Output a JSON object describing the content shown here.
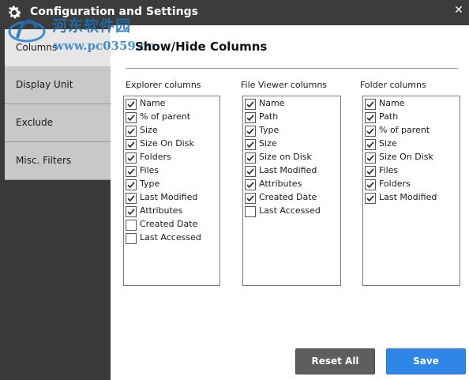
{
  "window": {
    "title": "Configuration and Settings",
    "close_glyph": "✕"
  },
  "watermark": {
    "name": "河东软件园",
    "url": "www.pc0359.cn"
  },
  "sidebar": {
    "items": [
      {
        "label": "Columns",
        "active": true
      },
      {
        "label": "Display Unit",
        "active": false
      },
      {
        "label": "Exclude",
        "active": false
      },
      {
        "label": "Misc. Filters",
        "active": false
      }
    ]
  },
  "main": {
    "title": "Show/Hide Columns",
    "groups": [
      {
        "heading": "Explorer columns",
        "items": [
          {
            "label": "Name",
            "checked": true
          },
          {
            "label": "% of parent",
            "checked": true
          },
          {
            "label": "Size",
            "checked": true
          },
          {
            "label": "Size On Disk",
            "checked": true
          },
          {
            "label": "Folders",
            "checked": true
          },
          {
            "label": "Files",
            "checked": true
          },
          {
            "label": "Type",
            "checked": true
          },
          {
            "label": "Last Modified",
            "checked": true
          },
          {
            "label": "Attributes",
            "checked": true
          },
          {
            "label": "Created Date",
            "checked": false
          },
          {
            "label": "Last Accessed",
            "checked": false
          }
        ]
      },
      {
        "heading": "File Viewer columns",
        "items": [
          {
            "label": "Name",
            "checked": true
          },
          {
            "label": "Path",
            "checked": true
          },
          {
            "label": "Type",
            "checked": true
          },
          {
            "label": "Size",
            "checked": true
          },
          {
            "label": "Size on Disk",
            "checked": true
          },
          {
            "label": "Last Modified",
            "checked": true
          },
          {
            "label": "Attributes",
            "checked": true
          },
          {
            "label": "Created Date",
            "checked": true
          },
          {
            "label": "Last Accessed",
            "checked": false
          }
        ]
      },
      {
        "heading": "Folder columns",
        "items": [
          {
            "label": "Name",
            "checked": true
          },
          {
            "label": "Path",
            "checked": true
          },
          {
            "label": "% of parent",
            "checked": true
          },
          {
            "label": "Size",
            "checked": true
          },
          {
            "label": "Size On Disk",
            "checked": true
          },
          {
            "label": "Files",
            "checked": true
          },
          {
            "label": "Folders",
            "checked": true
          },
          {
            "label": "Last Modified",
            "checked": true
          }
        ]
      }
    ]
  },
  "buttons": {
    "reset_label": "Reset All",
    "save_label": "Save"
  },
  "colors": {
    "titlebar": "#3c3c3c",
    "sidebar_bg": "#3a3a3a",
    "tab_bg": "#c8c8c8",
    "save_blue": "#2f86e6",
    "reset_gray": "#5e5e5e"
  }
}
